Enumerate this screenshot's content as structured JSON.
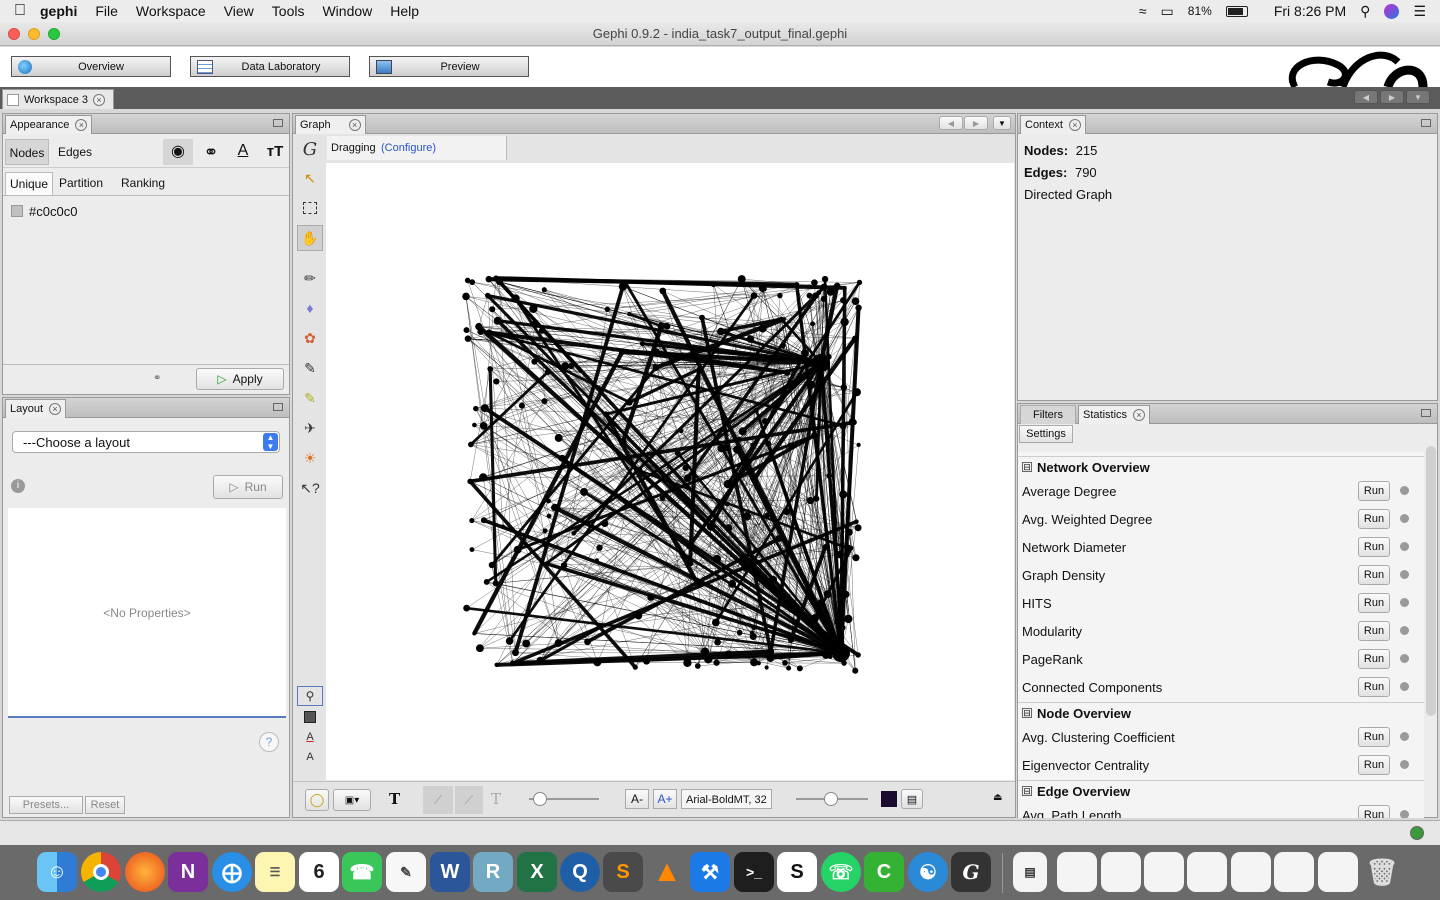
{
  "menubar": {
    "app": "gephi",
    "items": [
      "File",
      "Workspace",
      "View",
      "Tools",
      "Window",
      "Help"
    ],
    "battery": "81%",
    "clock": "Fri 8:26 PM"
  },
  "window": {
    "title": "Gephi 0.9.2 - india_task7_output_final.gephi"
  },
  "perspectives": {
    "overview": "Overview",
    "data_lab": "Data Laboratory",
    "preview": "Preview"
  },
  "workspace_tab": "Workspace 3",
  "appearance": {
    "title": "Appearance",
    "tabs": [
      "Nodes",
      "Edges"
    ],
    "modes": [
      "Unique",
      "Partition",
      "Ranking"
    ],
    "color_value": "#c0c0c0",
    "apply": "Apply"
  },
  "layout": {
    "title": "Layout",
    "select_value": "---Choose a layout",
    "run": "Run",
    "no_props": "<No Properties>",
    "presets": "Presets...",
    "reset": "Reset"
  },
  "graph": {
    "title": "Graph",
    "mode": "Dragging",
    "configure": "(Configure)",
    "font_label": "Arial-BoldMT, 32"
  },
  "context": {
    "title": "Context",
    "nodes_label": "Nodes:",
    "nodes_value": "215",
    "edges_label": "Edges:",
    "edges_value": "790",
    "graph_type": "Directed Graph"
  },
  "stats": {
    "tabs": [
      "Filters",
      "Statistics"
    ],
    "settings": "Settings",
    "run_label": "Run",
    "sections": [
      {
        "name": "Network Overview",
        "items": [
          "Average Degree",
          "Avg. Weighted Degree",
          "Network Diameter",
          "Graph Density",
          "HITS",
          "Modularity",
          "PageRank",
          "Connected Components"
        ]
      },
      {
        "name": "Node Overview",
        "items": [
          "Avg. Clustering Coefficient",
          "Eigenvector Centrality"
        ]
      },
      {
        "name": "Edge Overview",
        "items": [
          "Avg. Path Length"
        ]
      }
    ]
  },
  "colors": {
    "accent_link": "#2b55c8",
    "canvas_bg": "#ffffff",
    "edge": "#000000"
  }
}
